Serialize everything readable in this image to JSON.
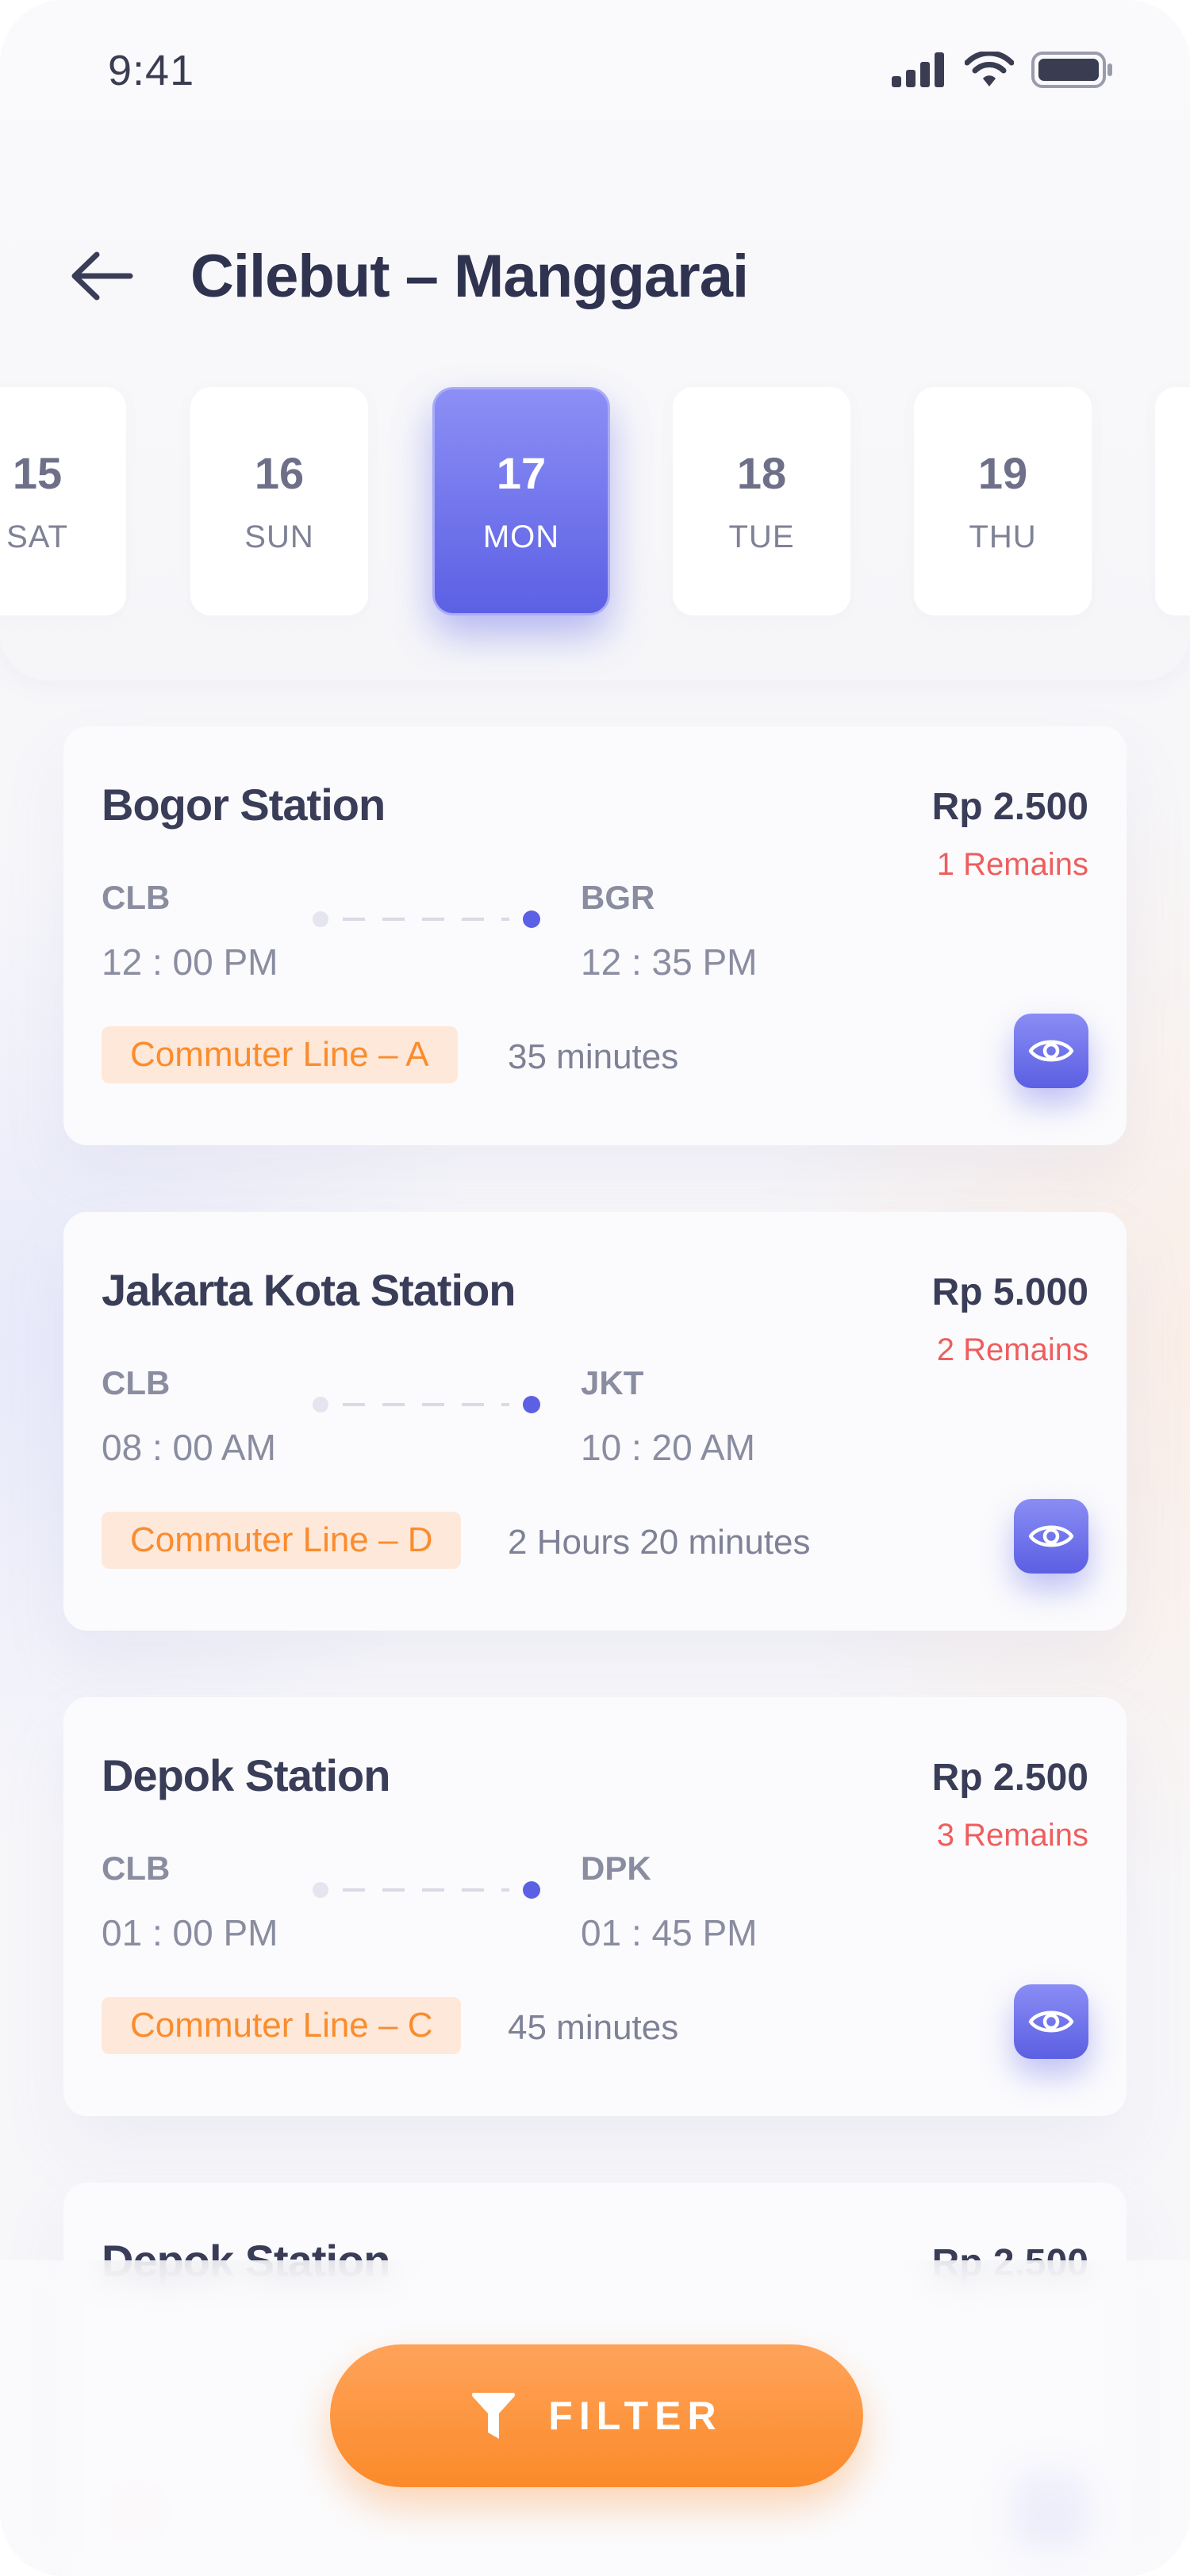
{
  "status_bar": {
    "time": "9:41"
  },
  "header": {
    "title": "Cilebut – Manggarai"
  },
  "dates": [
    {
      "num": "15",
      "day": "SAT",
      "active": false
    },
    {
      "num": "16",
      "day": "SUN",
      "active": false
    },
    {
      "num": "17",
      "day": "MON",
      "active": true
    },
    {
      "num": "18",
      "day": "TUE",
      "active": false
    },
    {
      "num": "19",
      "day": "THU",
      "active": false
    }
  ],
  "trips": [
    {
      "station": "Bogor Station",
      "price": "Rp 2.500",
      "remains": "1 Remains",
      "from_code": "CLB",
      "from_time": "12 : 00 PM",
      "to_code": "BGR",
      "to_time": "12 : 35 PM",
      "line": "Commuter Line – A",
      "duration": "35 minutes"
    },
    {
      "station": "Jakarta Kota Station",
      "price": "Rp 5.000",
      "remains": "2 Remains",
      "from_code": "CLB",
      "from_time": "08 : 00 AM",
      "to_code": "JKT",
      "to_time": "10 : 20 AM",
      "line": "Commuter Line – D",
      "duration": "2 Hours 20 minutes"
    },
    {
      "station": "Depok Station",
      "price": "Rp 2.500",
      "remains": "3 Remains",
      "from_code": "CLB",
      "from_time": "01 : 00 PM",
      "to_code": "DPK",
      "to_time": "01 : 45 PM",
      "line": "Commuter Line – C",
      "duration": "45 minutes"
    },
    {
      "station": "Depok Station",
      "price": "Rp 2.500",
      "remains": "",
      "from_code": "",
      "from_time": "",
      "to_code": "",
      "to_time": "",
      "line": "",
      "duration": ""
    }
  ],
  "filter": {
    "label": "FILTER",
    "icon": "filter-icon"
  },
  "colors": {
    "accent": "#5c60e4",
    "orange": "#fb8a2d",
    "danger": "#ee5e5e",
    "text": "#2f3350"
  }
}
